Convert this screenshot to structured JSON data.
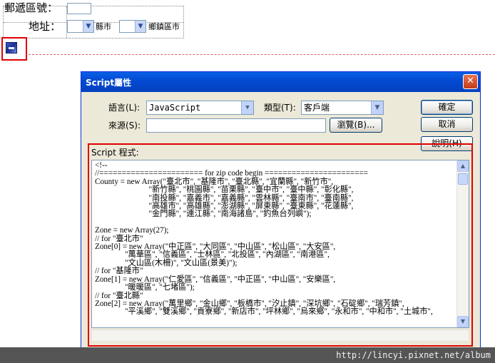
{
  "editor": {
    "zip_label": "郵遞區號：",
    "address_label": "地址：",
    "city_label": "縣市",
    "town_label": "鄉鎮區市"
  },
  "dialog": {
    "title": "Script屬性",
    "language_label": "語言(L):",
    "language_value": "JavaScript",
    "type_label": "類型(T):",
    "type_value": "客戶端",
    "source_label": "來源(S):",
    "source_value": "",
    "browse_button": "瀏覽(B)...",
    "ok_button": "確定",
    "cancel_button": "取消",
    "help_button": "說明(H)",
    "script_label": "Script 程式:",
    "code": "<!--\n//======================= for zip code begin =======================\nCounty = new Array(\"臺北市\", \"基隆市\", \"臺北縣\", \"宜蘭縣\", \"新竹市\",\n                           \"新竹縣\", \"桃園縣\", \"苗栗縣\", \"臺中市\", \"臺中縣\", \"彰化縣\",\n                           \"南投縣\", \"嘉義市\", \"嘉義縣\", \"雲林縣\", \"臺南市\", \"臺南縣\",\n                           \"高雄市\", \"高雄縣\", \"澎湖縣\", \"屏東縣\", \"臺東縣\", \"花蓮縣\",\n                           \"金門縣\", \"連江縣\", \"南海諸島\", \"釣魚台列嶼\");\n\nZone = new Array(27);\n// for \"臺北市\"\nZone[0] = new Array(\"中正區\", \"大同區\", \"中山區\", \"松山區\", \"大安區\",\n               \"萬華區\", \"信義區\", \"士林區\", \"北投區\", \"內湖區\", \"南港區\",\n               \"文山區(木柵)\", \"文山區(景美)\");\n// for \"基隆市\"\nZone[1] = new Array(\"仁愛區\", \"信義區\", \"中正區\", \"中山區\", \"安樂區\",\n               \"暖暖區\", \"七堵區\");\n// for \"臺北縣\"\nZone[2] = new Array(\"萬里鄉\", \"金山鄉\", \"板橋市\", \"汐止鎮\", \"深坑鄉\", \"石碇鄉\", \"瑞芳鎮\",\n               \"平溪鄉\", \"雙溪鄉\", \"貢寮鄉\", \"新店市\", \"坪林鄉\", \"烏來鄉\", \"永和市\", \"中和市\", \"土城市\","
  },
  "watermark": "http://lincyi.pixnet.net/album",
  "colors": {
    "highlight_border": "#e00000",
    "titlebar": "#0349d1",
    "dialog_bg": "#ece9d8"
  },
  "icons": {
    "close": "close-icon",
    "dropdown": "chevron-down-icon",
    "script": "script-icon"
  }
}
